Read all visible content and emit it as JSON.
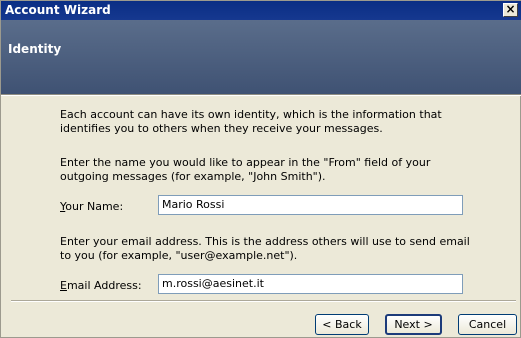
{
  "window": {
    "title": "Account Wizard",
    "close_label": "×"
  },
  "header": {
    "title": "Identity"
  },
  "content": {
    "intro": "Each account can have its own identity, which is the information that identifies you to others when they receive your messages.",
    "name_prompt": "Enter the name you would like to appear in the \"From\" field of your outgoing messages (for example, \"John Smith\").",
    "name_label_accel": "Y",
    "name_label_rest": "our Name:",
    "name_value": "Mario Rossi",
    "email_prompt": "Enter your email address. This is the address others will use to send email to you (for example, \"user@example.net\").",
    "email_label_accel": "E",
    "email_label_rest": "mail Address:",
    "email_value": "m.rossi@aesinet.it"
  },
  "buttons": {
    "back": "< Back",
    "next": "Next >",
    "cancel": "Cancel"
  }
}
